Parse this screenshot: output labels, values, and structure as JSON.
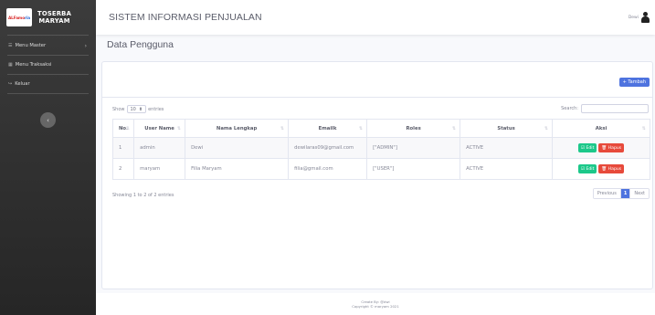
{
  "brand": {
    "logo_text_red": "ALFamo",
    "logo_text_blue": "ria",
    "line1": "TOSERBA",
    "line2": "MARYAM"
  },
  "sidebar": {
    "items": [
      {
        "icon": "list-icon",
        "label": "Menu Master",
        "has_chevron": true
      },
      {
        "icon": "table-icon",
        "label": "Menu Traksaksi"
      },
      {
        "icon": "logout-icon",
        "label": "Keluar"
      }
    ],
    "toggle_glyph": "‹"
  },
  "topbar": {
    "title": "SISTEM INFORMASI PENJUALAN",
    "user_name": "Dewi"
  },
  "page": {
    "title": "Data Pengguna"
  },
  "card": {
    "add_button": "+ Tambah",
    "show_label": "Show",
    "entries_value": "10",
    "entries_label": "entries",
    "search_label": "Search:",
    "search_value": "",
    "columns": [
      "No.",
      "User Name",
      "Nama Lengkap",
      "Emailk",
      "Roles",
      "Status",
      "Aksi"
    ],
    "rows": [
      {
        "no": "1",
        "username": "admin",
        "nama": "Dewi",
        "email": "dewilaras09@gmail.com",
        "roles": "[\"ADMIN\"]",
        "status": "ACTIVE"
      },
      {
        "no": "2",
        "username": "maryam",
        "nama": "Filia Maryam",
        "email": "filia@gmail.com",
        "roles": "[\"USER\"]",
        "status": "ACTIVE"
      }
    ],
    "edit_label": "☑ Edit",
    "delete_label": "🗑 Hapus",
    "info": "Showing 1 to 2 of 2 entries",
    "pager": {
      "previous": "Previous",
      "current": "1",
      "next": "Next"
    }
  },
  "footer": {
    "line1": "Create By: @dwi",
    "line2": "Copyright © maryam 2021"
  },
  "colors": {
    "primary": "#4e73df",
    "success": "#1cc88a",
    "danger": "#e74a3b",
    "sidebar_dark": "#262626"
  }
}
